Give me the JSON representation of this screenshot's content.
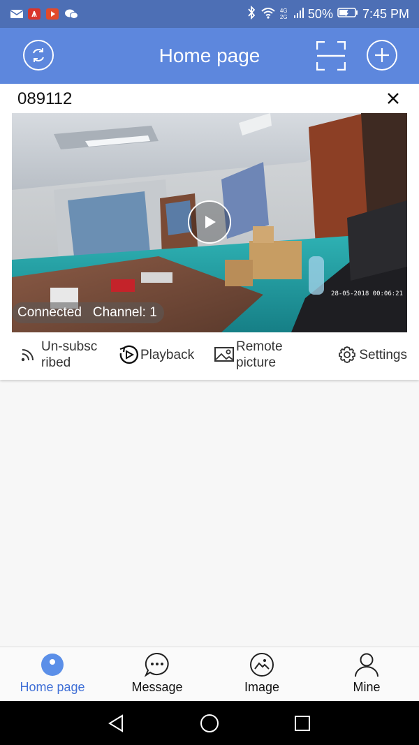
{
  "status_bar": {
    "battery": "50%",
    "time": "7:45 PM",
    "network": "4G 2G",
    "icons": [
      "mail-icon",
      "huawei-app-icon",
      "video-app-icon",
      "wechat-icon",
      "bluetooth-icon",
      "wifi-icon",
      "signal-icon",
      "battery-icon"
    ]
  },
  "header": {
    "title": "Home page",
    "left_icon": "refresh-icon",
    "scan_icon": "scan-icon",
    "add_icon": "add-icon"
  },
  "device": {
    "name": "089112",
    "status": "Connected",
    "channel": "Channel: 1",
    "timestamp": "28-05-2018 00:06:21"
  },
  "actions": [
    {
      "label": "Un-subsc ribed",
      "icon": "rss-icon"
    },
    {
      "label": "Playback",
      "icon": "playback-icon"
    },
    {
      "label": "Remote picture",
      "icon": "picture-icon"
    },
    {
      "label": "Settings",
      "icon": "settings-icon"
    }
  ],
  "tabs": [
    {
      "label": "Home page",
      "icon": "camera-icon",
      "active": true
    },
    {
      "label": "Message",
      "icon": "message-icon",
      "active": false
    },
    {
      "label": "Image",
      "icon": "image-icon",
      "active": false
    },
    {
      "label": "Mine",
      "icon": "person-icon",
      "active": false
    }
  ],
  "colors": {
    "status_bar": "#4d6fb5",
    "app_bar": "#5d87dd",
    "accent": "#3f6fd6"
  }
}
